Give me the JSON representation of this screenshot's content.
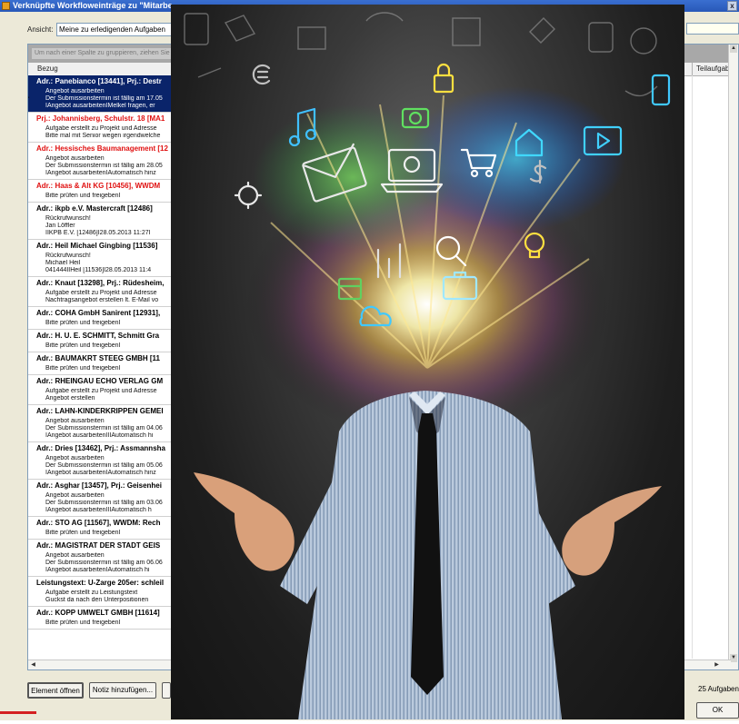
{
  "window": {
    "title": "Verknüpfte Workfloweinträge zu \"Mitarbe",
    "close_label": "x"
  },
  "view": {
    "label": "Ansicht:",
    "value": "Meine zu erledigenden Aufgaben"
  },
  "grid": {
    "group_hint": "Um nach einer Spalte zu gruppieren, ziehen Sie",
    "columns": [
      "Bezug",
      "Teilaufgabe"
    ],
    "records": [
      {
        "head": "Adr.: Panebianco [13441], Prj.: Destr",
        "lines": [
          "Angebot ausarbeiten",
          "Der Submissionstermin ist fällig am 17.05",
          "IAngebot ausarbeitenIMelkel fragen, er"
        ],
        "selected": true,
        "red": false
      },
      {
        "head": "Prj.: Johannisberg, Schulstr. 18 [MA1",
        "lines": [
          "Aufgabe erstellt zu Projekt und Adresse",
          "Bitte mal mit Senior wegen irgendwelche"
        ],
        "selected": false,
        "red": true
      },
      {
        "head": "Adr.: Hessisches Baumanagement [12",
        "lines": [
          "Angebot ausarbeiten",
          "Der Submissionstermin ist fällig am 28.05",
          "IAngebot ausarbeitenIAutomatisch hinz"
        ],
        "selected": false,
        "red": true
      },
      {
        "head": "Adr.: Haas & Alt KG [10456], WWDM",
        "lines": [
          "Bitte prüfen und freigebenI"
        ],
        "selected": false,
        "red": true
      },
      {
        "head": "Adr.: ikpb e.V. Mastercraft [12486]",
        "lines": [
          "Rückrufwunsch!",
          "Jan Löffler",
          "IIKPB E.V. [12486]I28.05.2013 11:27I"
        ],
        "selected": false,
        "red": false
      },
      {
        "head": "Adr.: Heil Michael Gingbing [11536]",
        "lines": [
          "Rückrufwunsch!",
          "Michael Heil",
          "041444IIHeil [11536]I28.05.2013 11:4"
        ],
        "selected": false,
        "red": false
      },
      {
        "head": "Adr.: Knaut [13298], Prj.: Rüdesheim,",
        "lines": [
          "Aufgabe erstellt zu Projekt und Adresse",
          "Nachtragsangebot erstellen lt. E-Mail vo"
        ],
        "selected": false,
        "red": false
      },
      {
        "head": "Adr.: COHA GmbH Sanirent [12931],",
        "lines": [
          "Bitte prüfen und freigebenI"
        ],
        "selected": false,
        "red": false
      },
      {
        "head": "Adr.: H. U. E. SCHMITT, Schmitt Gra",
        "lines": [
          "Bitte prüfen und freigebenI"
        ],
        "selected": false,
        "red": false
      },
      {
        "head": "Adr.: BAUMAKRT STEEG GMBH [11",
        "lines": [
          "Bitte prüfen und freigebenI"
        ],
        "selected": false,
        "red": false
      },
      {
        "head": "Adr.: RHEINGAU ECHO VERLAG GM",
        "lines": [
          "Aufgabe erstellt zu Projekt und Adresse",
          "Angebot erstellen"
        ],
        "selected": false,
        "red": false
      },
      {
        "head": "Adr.: LAHN-KINDERKRIPPEN GEMEI",
        "lines": [
          "Angebot ausarbeiten",
          "Der Submissionstermin ist fällig am 04.06",
          "IAngebot ausarbeitenIIIAutomatisch hi"
        ],
        "selected": false,
        "red": false
      },
      {
        "head": "Adr.: Dries [13462], Prj.: Assmannsha",
        "lines": [
          "Angebot ausarbeiten",
          "Der Submissionstermin ist fällig am 05.06",
          "IAngebot ausarbeitenIAutomatisch hinz"
        ],
        "selected": false,
        "red": false
      },
      {
        "head": "Adr.: Asghar [13457], Prj.: Geisenhei",
        "lines": [
          "Angebot ausarbeiten",
          "Der Submissionstermin ist fällig am 03.06",
          "IAngebot ausarbeitenIIIAutomatisch h"
        ],
        "selected": false,
        "red": false
      },
      {
        "head": "Adr.: STO AG [11567], WWDM: Rech",
        "lines": [
          "Bitte prüfen und freigebenI"
        ],
        "selected": false,
        "red": false
      },
      {
        "head": "Adr.: MAGISTRAT DER STADT GEIS",
        "lines": [
          "Angebot ausarbeiten",
          "Der Submissionstermin ist fällig am 06.06",
          "IAngebot ausarbeitenIAutomatisch hi"
        ],
        "selected": false,
        "red": false
      },
      {
        "head": "Leistungstext: U-Zarge 205er: schleil",
        "lines": [
          "Aufgabe erstellt zu Leistungstext",
          "Guckst da nach den Unterpositionen"
        ],
        "selected": false,
        "red": false
      },
      {
        "head": "Adr.: KOPP UMWELT GMBH [11614]",
        "lines": [
          "Bitte prüfen und freigebenI"
        ],
        "selected": false,
        "red": false
      }
    ]
  },
  "buttons": {
    "open": "Element öffnen",
    "note": "Notiz hinzufügen...",
    "ok": "OK"
  },
  "status": "25 Aufgaben",
  "overlay_icons": [
    "envelope-icon",
    "laptop-icon",
    "camera-icon",
    "lock-icon",
    "music-icon",
    "home-icon",
    "play-icon",
    "shopping-cart-icon",
    "magnifier-icon",
    "briefcase-icon",
    "calendar-icon",
    "cloud-icon",
    "chart-icon",
    "phone-icon",
    "gear-icon",
    "euro-icon",
    "dollar-icon",
    "lightbulb-icon"
  ]
}
